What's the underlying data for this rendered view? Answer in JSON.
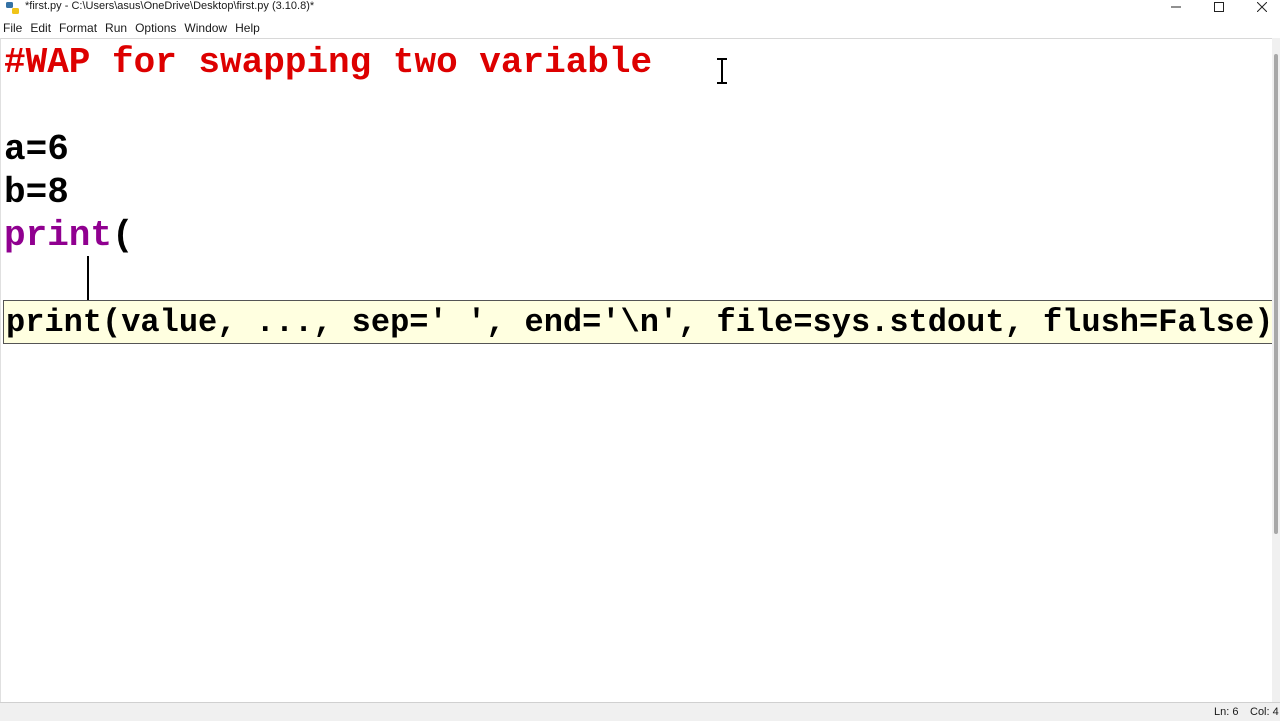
{
  "window": {
    "title": "*first.py - C:\\Users\\asus\\OneDrive\\Desktop\\first.py (3.10.8)*"
  },
  "menu": [
    "File",
    "Edit",
    "Format",
    "Run",
    "Options",
    "Window",
    "Help"
  ],
  "editor": {
    "lines": {
      "comment": "#WAP for swapping two variable",
      "line3": "a=6",
      "line4": "b=8",
      "line5_keyword": "print",
      "line5_rest": "("
    },
    "calltip": "print(value, ..., sep=' ', end='\\n', file=sys.stdout, flush=False)"
  },
  "status": {
    "ln": "Ln: 6",
    "col": "Col: 4"
  },
  "colors": {
    "comment": "#dd0000",
    "builtin": "#900090",
    "calltip_bg": "#ffffe0"
  }
}
